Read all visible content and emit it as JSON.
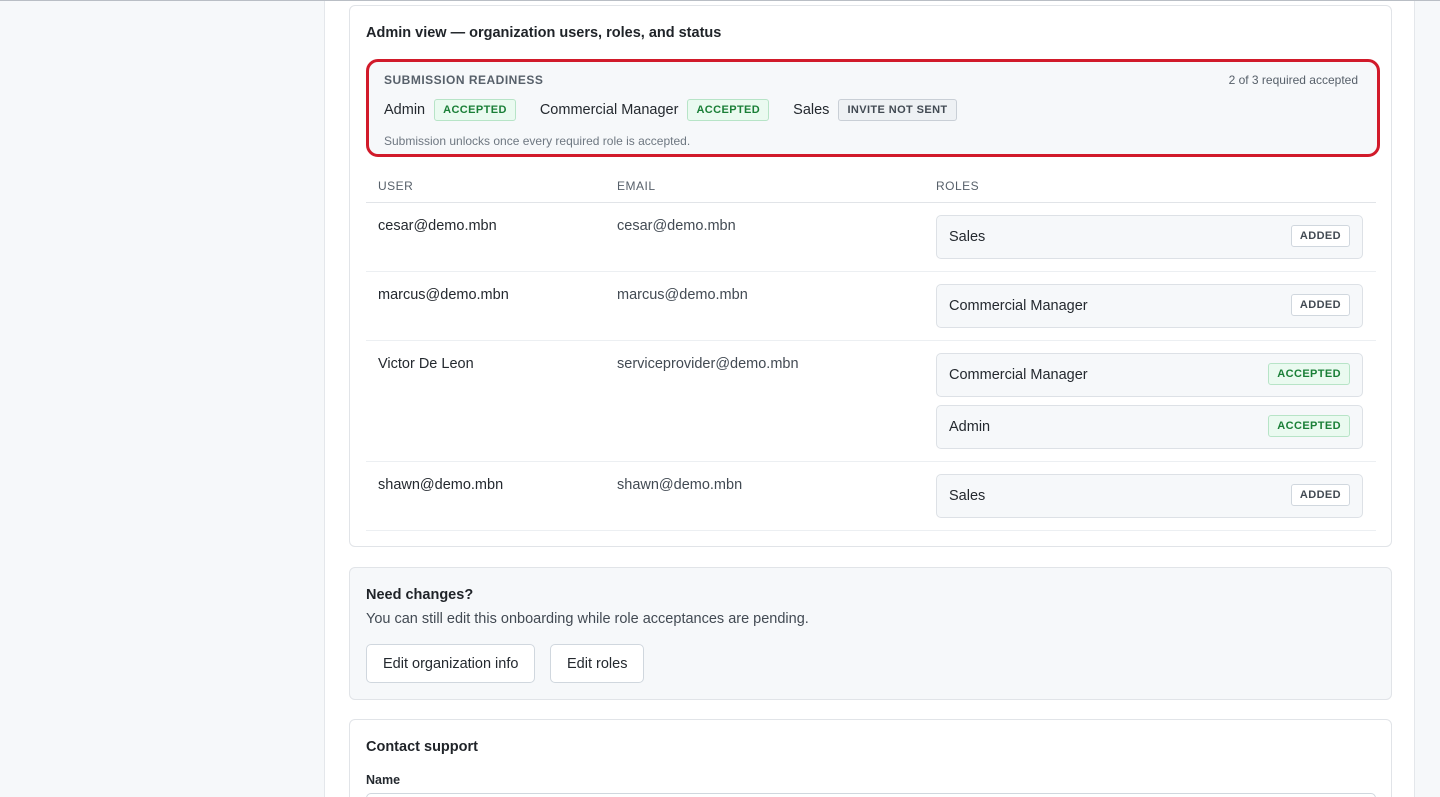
{
  "admin": {
    "title": "Admin view — organization users, roles, and status",
    "readiness": {
      "title": "SUBMISSION READINESS",
      "count": "2 of 3 required accepted",
      "roles": [
        {
          "name": "Admin",
          "status": "ACCEPTED"
        },
        {
          "name": "Commercial Manager",
          "status": "ACCEPTED"
        },
        {
          "name": "Sales",
          "status": "INVITE NOT SENT"
        }
      ],
      "note": "Submission unlocks once every required role is accepted."
    },
    "table": {
      "headers": {
        "user": "USER",
        "email": "EMAIL",
        "roles": "ROLES"
      },
      "rows": [
        {
          "user": "cesar@demo.mbn",
          "email": "cesar@demo.mbn",
          "roles": [
            {
              "name": "Sales",
              "status": "ADDED"
            }
          ]
        },
        {
          "user": "marcus@demo.mbn",
          "email": "marcus@demo.mbn",
          "roles": [
            {
              "name": "Commercial Manager",
              "status": "ADDED"
            }
          ]
        },
        {
          "user": "Victor De Leon",
          "email": "serviceprovider@demo.mbn",
          "roles": [
            {
              "name": "Commercial Manager",
              "status": "ACCEPTED"
            },
            {
              "name": "Admin",
              "status": "ACCEPTED"
            }
          ]
        },
        {
          "user": "shawn@demo.mbn",
          "email": "shawn@demo.mbn",
          "roles": [
            {
              "name": "Sales",
              "status": "ADDED"
            }
          ]
        }
      ]
    }
  },
  "changes": {
    "title": "Need changes?",
    "description": "You can still edit this onboarding while role acceptances are pending.",
    "edit_org_label": "Edit organization info",
    "edit_roles_label": "Edit roles"
  },
  "support": {
    "title": "Contact support",
    "name_label": "Name",
    "name_value": ""
  },
  "colors": {
    "accepted": "#1a7f37",
    "highlight_border": "#d11a2a"
  }
}
